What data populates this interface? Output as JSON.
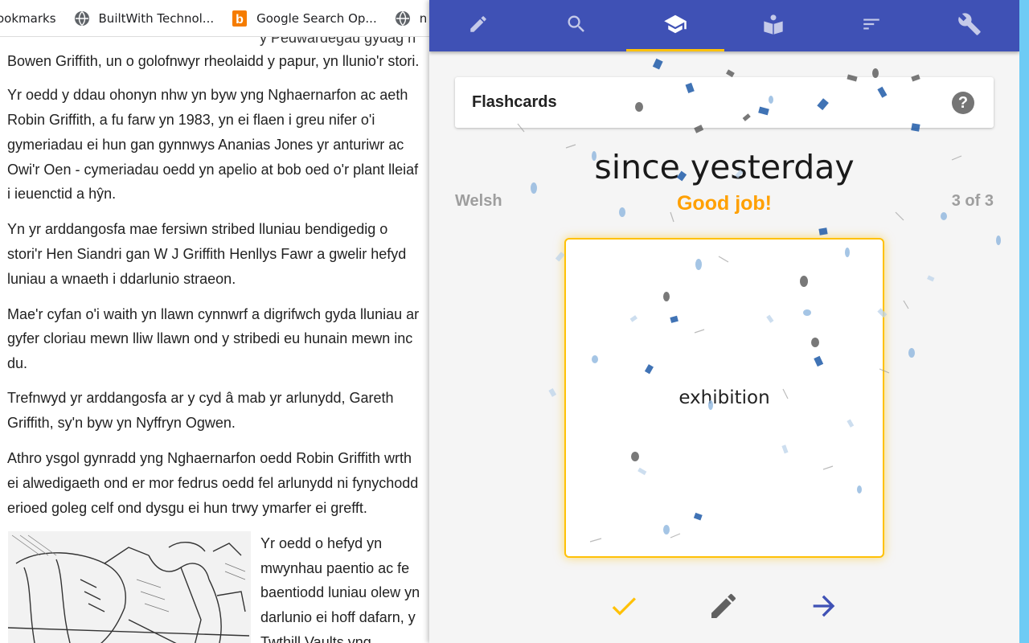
{
  "browser": {
    "bookmarks": [
      {
        "label": "ookmarks",
        "icon": "bookmarks-folder-icon"
      },
      {
        "label": "BuiltWith Technol...",
        "icon": "globe-icon"
      },
      {
        "label": "Google Search Op...",
        "icon": "bing-b-icon"
      },
      {
        "label": "n",
        "icon": "globe-icon"
      }
    ]
  },
  "article": {
    "partial_top": "y Pedwardegau gydag h",
    "lines": [
      "Bowen Griffith, un o golofnwyr rheolaidd y papur, yn llunio'r stori.",
      "Yr oedd y ddau ohonyn nhw yn byw yng Nghaernarfon ac aeth",
      "Robin Griffith, a fu farw yn 1983, yn ei flaen i greu nifer o'i",
      "gymeriadau ei hun gan gynnwys Ananias Jones yr anturiwr ac",
      "Owi'r Oen - cymeriadau oedd yn apelio at bob oed o'r plant lleiaf",
      "i ieuenctid a hŷn.",
      "Yn yr arddangosfa mae fersiwn stribed lluniau bendigedig o",
      "stori'r Hen Siandri gan W J Griffith Henllys Fawr a gwelir hefyd",
      "luniau a wnaeth i ddarlunio straeon.",
      "Mae'r cyfan o'i waith yn llawn cynnwrf a digrifwch gyda lluniau ar",
      "gyfer cloriau mewn lliw llawn ond y stribedi eu hunain mewn inc",
      "du.",
      "Trefnwyd yr arddangosfa ar y cyd â mab yr arlunydd, Gareth",
      "Griffith, sy'n byw yn Nyffryn Ogwen.",
      "Athro ysgol gynradd yng Nghaernarfon oedd Robin Griffith wrth",
      "ei alwedigaeth ond er mor fedrus oedd fel arlunydd ni fynychodd",
      "erioed goleg celf ond dysgu ei hun trwy ymarfer ei grefft."
    ],
    "side_lines": [
      "Yr oedd o hefyd yn",
      "mwynhau paentio ac fe",
      "baentiodd luniau olew yn",
      "darlunio ei hoff dafarn, y",
      "Twthill Vaults yng"
    ]
  },
  "panel": {
    "toolbar": {
      "color": "#3f51b5",
      "accent": "#ffc107",
      "tabs": [
        {
          "icon": "pencil-icon",
          "active": false
        },
        {
          "icon": "search-icon",
          "active": false
        },
        {
          "icon": "graduation-cap-icon",
          "active": true
        },
        {
          "icon": "book-reader-icon",
          "active": false
        },
        {
          "icon": "sort-icon",
          "active": false
        },
        {
          "icon": "wrench-icon",
          "active": false
        }
      ]
    },
    "header": {
      "title": "Flashcards",
      "help_label": "?"
    },
    "term": "since yesterday",
    "language": "Welsh",
    "feedback": "Good job!",
    "progress": "3 of 3",
    "card": {
      "answer": "exhibition"
    },
    "actions": [
      {
        "icon": "check-icon",
        "color": "#ffc107"
      },
      {
        "icon": "edit-pencil-icon",
        "color": "#616161"
      },
      {
        "icon": "arrow-right-icon",
        "color": "#3f51b5"
      }
    ]
  }
}
